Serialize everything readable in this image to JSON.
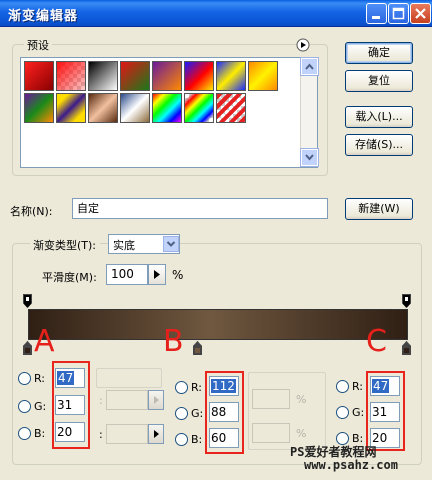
{
  "window": {
    "title": "渐变编辑器"
  },
  "presets": {
    "label": "预设",
    "swatch_icons": [
      "red-gradient",
      "red-transparent-checker",
      "black-white-gradient",
      "red-green-gradient",
      "violet-orange-gradient",
      "blue-red-yellow-gradient",
      "blue-yellow-blue-gradient",
      "orange-yellow-orange-gradient",
      "violet-green-orange-gradient",
      "yellow-violet-gradient",
      "copper-gradient",
      "chrome-gradient",
      "spectrum-gradient",
      "transparent-rainbow-gradient",
      "transparent-stripes-gradient"
    ]
  },
  "buttons": {
    "ok": "确定",
    "reset": "复位",
    "load": "载入(L)...",
    "save": "存储(S)...",
    "new": "新建(W)"
  },
  "name": {
    "label": "名称(N):",
    "value": "自定"
  },
  "gradient": {
    "group_label": "渐变类型(T):",
    "type_value": "实底",
    "smoothness_label": "平滑度(M):",
    "smoothness_value": "100",
    "percent": "%"
  },
  "stops": {
    "A": {
      "letter": "A",
      "r": "47",
      "g": "31",
      "b": "20"
    },
    "B": {
      "letter": "B",
      "r": "112",
      "g": "88",
      "b": "60"
    },
    "C": {
      "letter": "C",
      "r": "47",
      "g": "31",
      "b": "20"
    }
  },
  "labels": {
    "r": "R:",
    "g": "G:",
    "b": "B:",
    "pct": "%"
  },
  "colors": {
    "stop_dark": "#2f1f14",
    "stop_mid": "#705840",
    "accent_red": "#e6201a"
  },
  "watermark": {
    "line1": "PS爱好者教程网",
    "line2": "www.psahz.com"
  }
}
